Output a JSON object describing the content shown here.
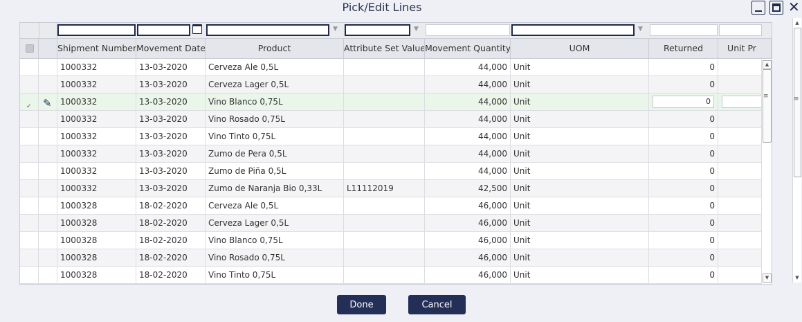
{
  "window": {
    "title": "Pick/Edit Lines"
  },
  "columns": [
    "",
    "",
    "Shipment Number",
    "Movement Date",
    "Product",
    "Attribute Set Value",
    "Movement Quantity",
    "UOM",
    "Returned",
    "Unit Pr"
  ],
  "rows": [
    {
      "shipment": "1000332",
      "date": "13-03-2020",
      "product": "Cerveza Ale 0,5L",
      "attr": "",
      "qty": "44,000",
      "uom": "Unit",
      "returned": "0"
    },
    {
      "shipment": "1000332",
      "date": "13-03-2020",
      "product": "Cerveza Lager 0,5L",
      "attr": "",
      "qty": "44,000",
      "uom": "Unit",
      "returned": "0"
    },
    {
      "shipment": "1000332",
      "date": "13-03-2020",
      "product": "Vino Blanco 0,75L",
      "attr": "",
      "qty": "44,000",
      "uom": "Unit",
      "returned": "0",
      "selected": true
    },
    {
      "shipment": "1000332",
      "date": "13-03-2020",
      "product": "Vino Rosado 0,75L",
      "attr": "",
      "qty": "44,000",
      "uom": "Unit",
      "returned": "0"
    },
    {
      "shipment": "1000332",
      "date": "13-03-2020",
      "product": "Vino Tinto 0,75L",
      "attr": "",
      "qty": "44,000",
      "uom": "Unit",
      "returned": "0"
    },
    {
      "shipment": "1000332",
      "date": "13-03-2020",
      "product": "Zumo de Pera 0,5L",
      "attr": "",
      "qty": "44,000",
      "uom": "Unit",
      "returned": "0"
    },
    {
      "shipment": "1000332",
      "date": "13-03-2020",
      "product": "Zumo de Piña 0,5L",
      "attr": "",
      "qty": "44,000",
      "uom": "Unit",
      "returned": "0"
    },
    {
      "shipment": "1000332",
      "date": "13-03-2020",
      "product": "Zumo de Naranja Bio 0,33L",
      "attr": "L11112019",
      "qty": "42,500",
      "uom": "Unit",
      "returned": "0"
    },
    {
      "shipment": "1000328",
      "date": "18-02-2020",
      "product": "Cerveza Ale 0,5L",
      "attr": "",
      "qty": "46,000",
      "uom": "Unit",
      "returned": "0"
    },
    {
      "shipment": "1000328",
      "date": "18-02-2020",
      "product": "Cerveza Lager 0,5L",
      "attr": "",
      "qty": "46,000",
      "uom": "Unit",
      "returned": "0"
    },
    {
      "shipment": "1000328",
      "date": "18-02-2020",
      "product": "Vino Blanco 0,75L",
      "attr": "",
      "qty": "46,000",
      "uom": "Unit",
      "returned": "0"
    },
    {
      "shipment": "1000328",
      "date": "18-02-2020",
      "product": "Vino Rosado 0,75L",
      "attr": "",
      "qty": "46,000",
      "uom": "Unit",
      "returned": "0"
    },
    {
      "shipment": "1000328",
      "date": "18-02-2020",
      "product": "Vino Tinto 0,75L",
      "attr": "",
      "qty": "46,000",
      "uom": "Unit",
      "returned": "0"
    }
  ],
  "buttons": {
    "done": "Done",
    "cancel": "Cancel"
  },
  "icons": {
    "minimize": "minimize-icon",
    "maximize": "maximize-icon",
    "close": "close-icon",
    "calendar": "calendar-icon",
    "pin": "pin-icon",
    "check": "check-icon"
  },
  "colors": {
    "primary": "#242f57",
    "selected_row": "#eaf6ea",
    "background": "#eef0f5"
  }
}
